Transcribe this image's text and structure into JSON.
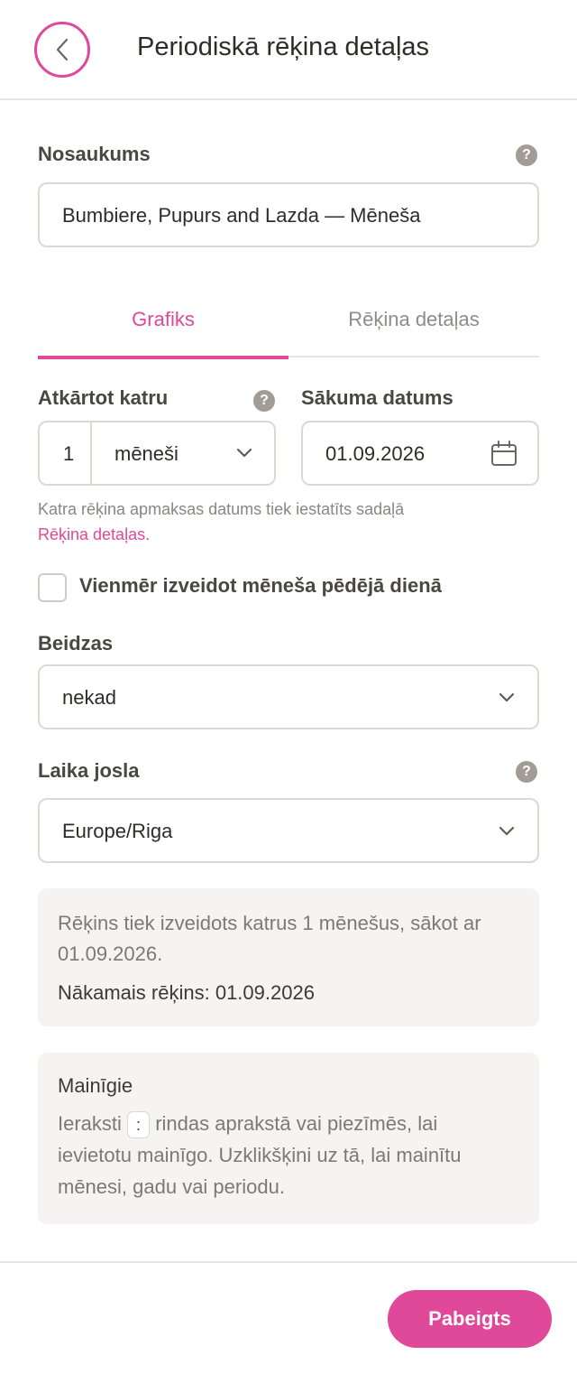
{
  "header": {
    "title": "Periodiskā rēķina detaļas"
  },
  "name_field": {
    "label": "Nosaukums",
    "value": "Bumbiere, Pupurs and Lazda — Mēneša"
  },
  "tabs": [
    {
      "label": "Grafiks",
      "active": true
    },
    {
      "label": "Rēķina detaļas",
      "active": false
    }
  ],
  "repeat": {
    "label": "Atkārtot katru",
    "count": "1",
    "unit": "mēneši"
  },
  "start_date": {
    "label": "Sākuma datums",
    "value": "01.09.2026"
  },
  "hint": {
    "text": "Katra rēķina apmaksas datums tiek iestatīts sadaļā",
    "link": "Rēķina detaļas."
  },
  "last_day_checkbox": {
    "label": "Vienmēr izveidot mēneša pēdējā dienā",
    "checked": false
  },
  "ends": {
    "label": "Beidzas",
    "value": "nekad"
  },
  "timezone": {
    "label": "Laika josla",
    "value": "Europe/Riga"
  },
  "summary": {
    "line1": "Rēķins tiek izveidots katrus 1 mēnešus, sākot ar",
    "line2": "01.09.2026.",
    "next_invoice": "Nākamais rēķins: 01.09.2026"
  },
  "variables": {
    "title": "Mainīgie",
    "line1_before": "Ieraksti",
    "key": ":",
    "line1_after": "rindas aprakstā vai piezīmēs, lai",
    "line2": "ievietotu mainīgo. Uzklikšķini uz tā, lai mainītu",
    "line3": "mēnesi, gadu vai periodu."
  },
  "footer": {
    "done_label": "Pabeigts"
  },
  "colors": {
    "accent": "#e0489a",
    "border": "#dcd9d5",
    "muted": "#8a8680",
    "panel": "#f5f4f2"
  }
}
